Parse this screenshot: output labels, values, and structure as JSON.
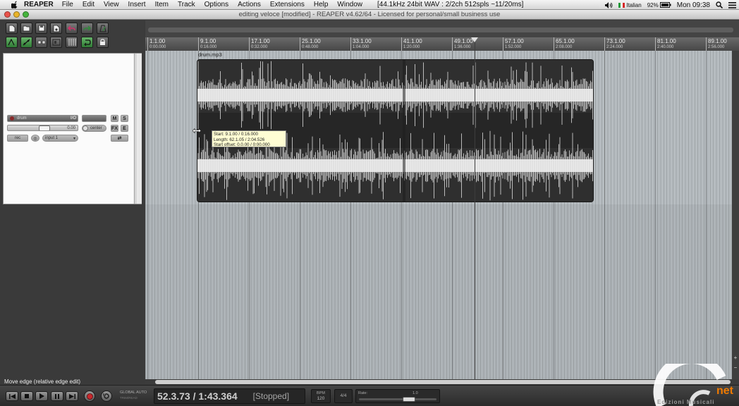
{
  "menubar": {
    "app": "REAPER",
    "items": [
      "File",
      "Edit",
      "View",
      "Insert",
      "Item",
      "Track",
      "Options",
      "Actions",
      "Extensions",
      "Help",
      "Window"
    ],
    "status": "[44.1kHz 24bit WAV : 2/2ch 512spls ~11/20ms]",
    "language": "Italian",
    "battery": "92%",
    "clock": "Mon 09:38"
  },
  "window": {
    "title": "editing veloce [modified] - REAPER v4.62/64 - Licensed for personal/small business use"
  },
  "track": {
    "name": "drum",
    "io_label": "I/O",
    "mute_label": "M",
    "solo_label": "S",
    "fader_value": "0.00",
    "pan_label": "center",
    "input_label": "input 1",
    "rec_mode_label": "rec"
  },
  "ruler": {
    "marks": [
      {
        "m": "1.1.00",
        "t": "0:00.000"
      },
      {
        "m": "9.1.00",
        "t": "0:16.000"
      },
      {
        "m": "17.1.00",
        "t": "0:32.000"
      },
      {
        "m": "25.1.00",
        "t": "0:48.000"
      },
      {
        "m": "33.1.00",
        "t": "1:04.000"
      },
      {
        "m": "41.1.00",
        "t": "1:20.000"
      },
      {
        "m": "49.1.00",
        "t": "1:36.000"
      },
      {
        "m": "57.1.00",
        "t": "1:52.000"
      },
      {
        "m": "65.1.00",
        "t": "2:08.000"
      },
      {
        "m": "73.1.00",
        "t": "2:24.000"
      },
      {
        "m": "81.1.00",
        "t": "2:40.000"
      },
      {
        "m": "89.1.00",
        "t": "2:56.000"
      }
    ]
  },
  "item": {
    "name": "drum.mp3",
    "tooltip": {
      "start": "Start: 9.1.00 / 0:16.000",
      "length": "Length: 62.1.05 / 2:04.526",
      "offset": "Start offset: 0.0.00 / 0:00.000"
    }
  },
  "status_hint": "Move edge (relative edge edit)",
  "transport": {
    "position": "52.3.73 / 1:43.364",
    "state": "[Stopped]",
    "global_auto": "GLOBAL AUTO",
    "bpm_label": "BPM",
    "bpm": "120",
    "timesig": "4/4",
    "rate_label": "Rate:",
    "rate": "1.0"
  },
  "logo": {
    "brand": "net",
    "subtitle": "Edizioni Musicali"
  },
  "colors": {
    "arrange_bg": "#b6bcc0",
    "item_bg": "#2f2f2f",
    "waveform": "#f2f2f2",
    "tooltip_bg": "#fffdd3",
    "record_button": "#c8282d",
    "logo_accent": "#f07a00"
  }
}
